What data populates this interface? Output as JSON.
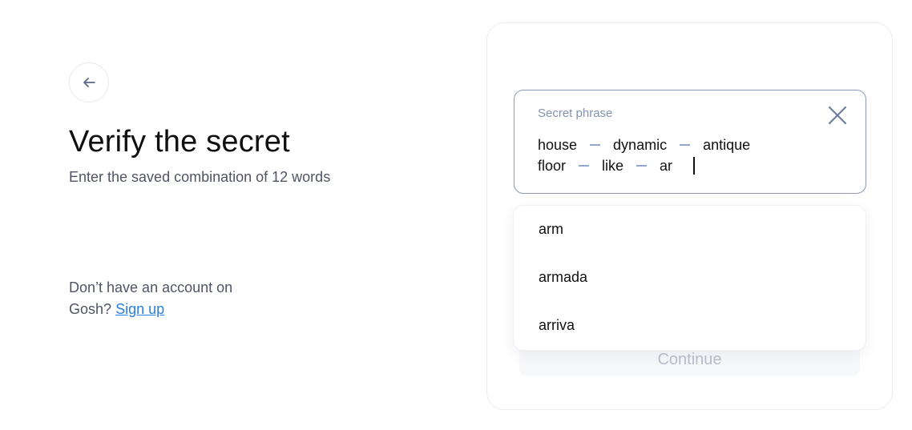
{
  "header": {
    "title": "Verify the secret",
    "subtitle": "Enter the saved combination of 12 words"
  },
  "signup": {
    "prompt": "Don’t have an account on Gosh?",
    "link_label": "Sign up"
  },
  "phrase": {
    "label": "Secret phrase",
    "words": [
      "house",
      "dynamic",
      "antique",
      "floor",
      "like"
    ],
    "current_input": "ar"
  },
  "suggestions": [
    "arm",
    "armada",
    "arriva"
  ],
  "actions": {
    "continue_label": "Continue"
  },
  "colors": {
    "input_border": "#8b98b5",
    "label": "#8592ad",
    "link": "#2b7fd6",
    "dash": "#94a8d0"
  },
  "icons": {
    "back": "arrow-left-icon",
    "clear": "close-icon"
  }
}
